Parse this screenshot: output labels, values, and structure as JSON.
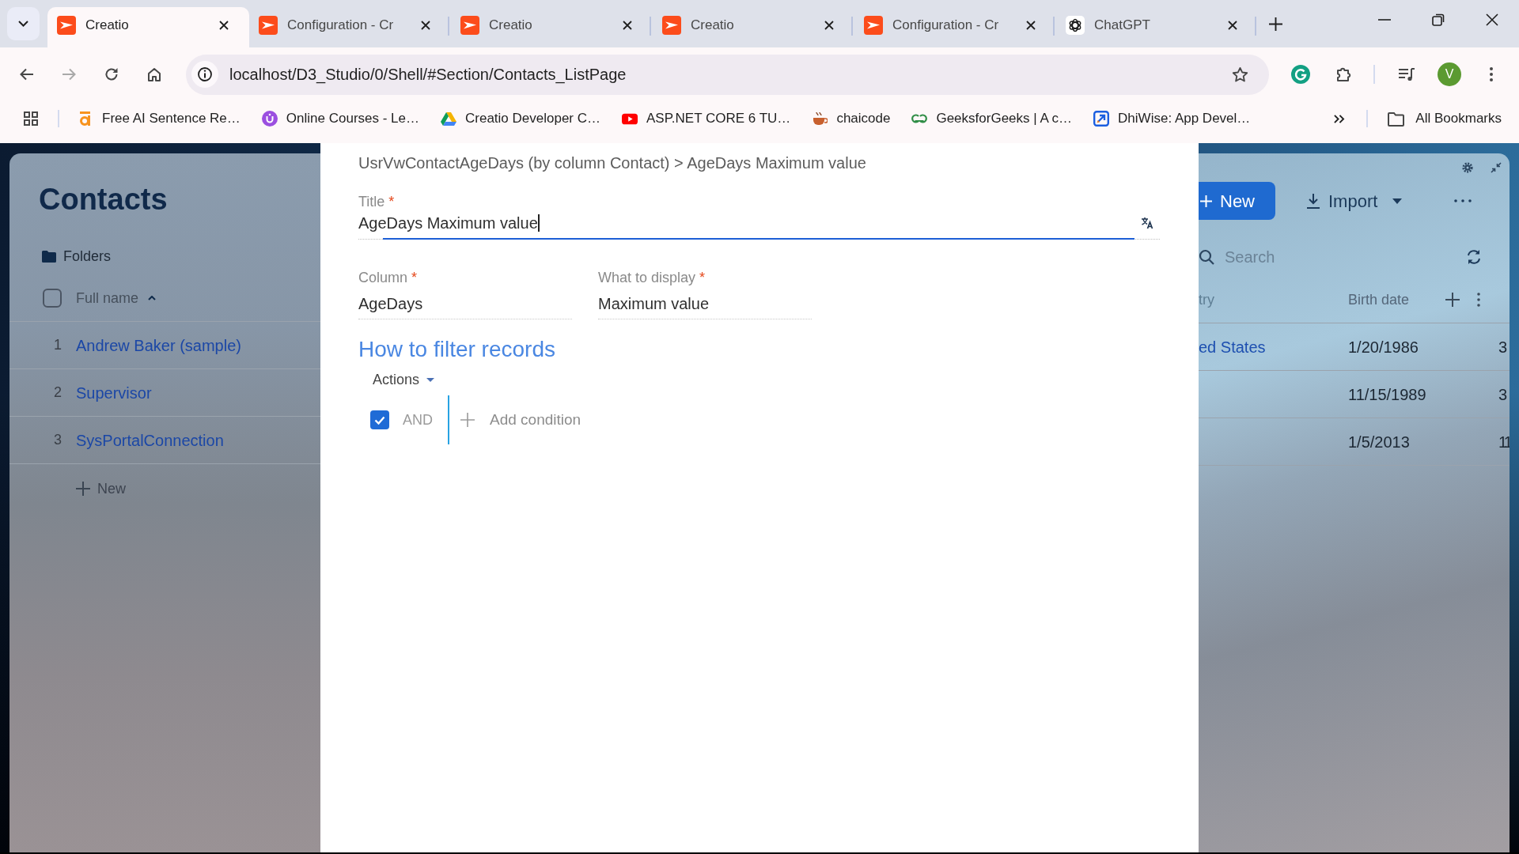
{
  "browser": {
    "tabs": [
      {
        "title": "Creatio",
        "kind": "creatio",
        "selected": true
      },
      {
        "title": "Configuration - Cr",
        "kind": "creatio",
        "selected": false
      },
      {
        "title": "Creatio",
        "kind": "creatio",
        "selected": false
      },
      {
        "title": "Creatio",
        "kind": "creatio",
        "selected": false
      },
      {
        "title": "Configuration - Cr",
        "kind": "creatio",
        "selected": false
      },
      {
        "title": "ChatGPT",
        "kind": "chatgpt",
        "selected": false
      }
    ],
    "address": "localhost/D3_Studio/0/Shell/#Section/Contacts_ListPage",
    "profile_initial": "V",
    "bookmarks": [
      {
        "label": "Free AI Sentence Re…",
        "kind": "sentence"
      },
      {
        "label": "Online Courses - Le…",
        "kind": "courses"
      },
      {
        "label": "Creatio Developer C…",
        "kind": "drive"
      },
      {
        "label": "ASP.NET CORE 6 TU…",
        "kind": "video"
      },
      {
        "label": "chaicode",
        "kind": "chai"
      },
      {
        "label": "GeeksforGeeks | A c…",
        "kind": "geeks"
      },
      {
        "label": "DhiWise: App Devel…",
        "kind": "dhiwise"
      }
    ],
    "all_bookmarks": "All Bookmarks"
  },
  "contacts_page": {
    "title": "Contacts",
    "folders": "Folders",
    "new_button": "New",
    "import_button": "Import",
    "search": {
      "placeholder": "Search"
    },
    "select_all": {
      "checked": false
    },
    "columns": [
      {
        "label": "Full name",
        "sorted": true
      },
      {
        "label": "try",
        "sorted": false
      },
      {
        "label": "Birth date",
        "sorted": false
      }
    ],
    "rows": [
      {
        "number": "1",
        "full_name": "Andrew Baker (sample)",
        "column_2": "ed States",
        "birth_date": "1/20/1986",
        "column_4": "3"
      },
      {
        "number": "2",
        "full_name": "Supervisor",
        "birth_date": "11/15/1989",
        "column_4": "3"
      },
      {
        "number": "3",
        "full_name": "SysPortalConnection",
        "birth_date": "1/5/2013",
        "column_4": "11"
      }
    ],
    "add_row": "New"
  },
  "dialog": {
    "breadcrumb": "UsrVwContactAgeDays (by column Contact) > AgeDays Maximum value",
    "title_field": {
      "label": "Title",
      "required_mark": "*",
      "value": "AgeDays Maximum value",
      "focused": true
    },
    "fields": [
      {
        "label": "Column",
        "required_mark": "*",
        "value": "AgeDays"
      },
      {
        "label": "What to display",
        "required_mark": "*",
        "value": "Maximum value"
      }
    ],
    "filter_heading": "How to filter records",
    "actions_menu": "Actions",
    "filter_group": {
      "checked": true,
      "operator": "AND",
      "add_condition": "Add condition"
    }
  }
}
